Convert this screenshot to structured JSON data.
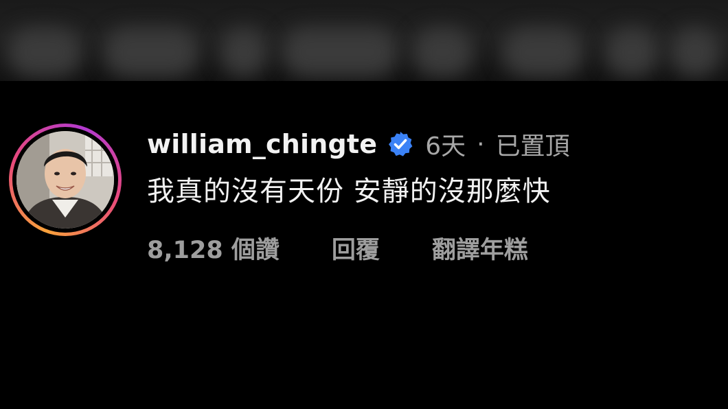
{
  "comment": {
    "username": "william_chingte",
    "verified_icon": "verified-badge-icon",
    "time": "6天",
    "separator": "·",
    "pinned_label": "已置頂",
    "text": "我真的沒有天份 安靜的沒那麼快",
    "likes_label": "8,128 個讚",
    "reply_label": "回覆",
    "translate_label": "翻譯年糕"
  },
  "colors": {
    "background": "#000000",
    "primary_text": "#f2f2f2",
    "secondary_text": "#a8a8a8",
    "verified_blue": "#3b82f6"
  }
}
